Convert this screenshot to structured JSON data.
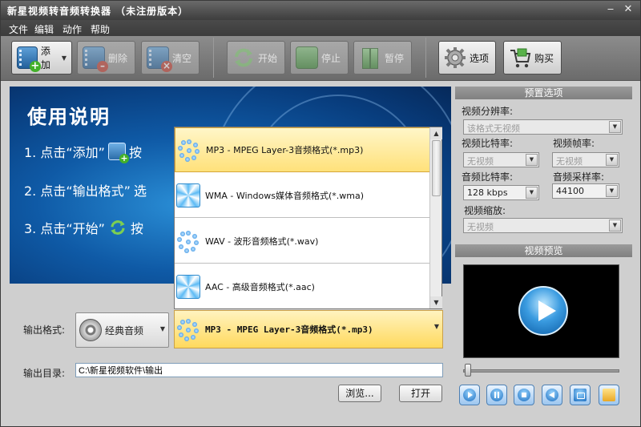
{
  "window": {
    "title": "新星视频转音频转换器 （未注册版本）",
    "minimize_icon": "minimize-icon",
    "close_icon": "close-icon"
  },
  "menu": {
    "items": [
      "文件",
      "编辑",
      "动作",
      "帮助"
    ]
  },
  "toolbar": {
    "add_label": "添加",
    "delete_label": "删除",
    "clear_label": "清空",
    "start_label": "开始",
    "stop_label": "停止",
    "pause_label": "暂停",
    "options_label": "选项",
    "buy_label": "购买"
  },
  "banner": {
    "heading": "使用说明",
    "step1": "1. 点击“添加”",
    "step1_after": "按",
    "step2": "2. 点击“输出格式”",
    "step2_after": "选",
    "step3": "3. 点击“开始”",
    "step3_after": "按"
  },
  "format_list": {
    "items": [
      {
        "name": "MP3 - MPEG Layer-3音频格式(*.mp3)",
        "icon": "mp3-format-icon",
        "selected": true
      },
      {
        "name": "WMA - Windows媒体音频格式(*.wma)",
        "icon": "wma-format-icon",
        "selected": false
      },
      {
        "name": "WAV - 波形音频格式(*.wav)",
        "icon": "wav-format-icon",
        "selected": false
      },
      {
        "name": "AAC - 高级音频格式(*.aac)",
        "icon": "aac-format-icon",
        "selected": false
      }
    ]
  },
  "output": {
    "format_label": "输出格式:",
    "category_value": "经典音频",
    "format_value": "MP3 - MPEG Layer-3音频格式(*.mp3)",
    "dir_label": "输出目录:",
    "dir_value": "C:\\新星视频软件\\输出",
    "browse_label": "浏览...",
    "open_label": "打开"
  },
  "preset": {
    "title": "预置选项",
    "resolution_label": "视频分辨率:",
    "resolution_value": "该格式无视频",
    "vbitrate_label": "视频比特率:",
    "vbitrate_value": "无视频",
    "fps_label": "视频帧率:",
    "fps_value": "无视频",
    "abitrate_label": "音频比特率:",
    "abitrate_value": "128 kbps",
    "samplerate_label": "音频采样率:",
    "samplerate_value": "44100",
    "scale_label": "视频缩放:",
    "scale_value": "无视频"
  },
  "preview": {
    "title": "视频预览",
    "seek_fraction": 0.0
  },
  "colors": {
    "selected_item": "#ffe17a",
    "banner_blue": "#0f5aa6"
  }
}
